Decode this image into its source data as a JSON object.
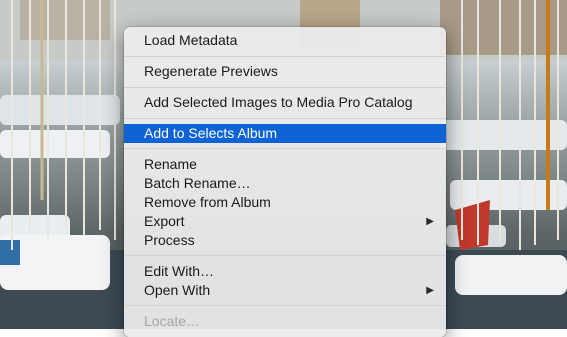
{
  "menu": {
    "items": [
      {
        "label": "Load Metadata"
      },
      {
        "label": "Regenerate Previews"
      },
      {
        "label": "Add Selected Images to Media Pro Catalog"
      },
      {
        "label": "Add to Selects Album",
        "state": "selected"
      },
      {
        "label": "Rename"
      },
      {
        "label": "Batch Rename…"
      },
      {
        "label": "Remove from Album"
      },
      {
        "label": "Export",
        "submenu_indicator": "▶"
      },
      {
        "label": "Process"
      },
      {
        "label": "Edit With…"
      },
      {
        "label": "Open With",
        "submenu_indicator": "▶"
      },
      {
        "label": "Locate…",
        "state": "disabled"
      }
    ]
  },
  "colors": {
    "selection": "#0d63d6",
    "menu_background": "#ececec"
  }
}
